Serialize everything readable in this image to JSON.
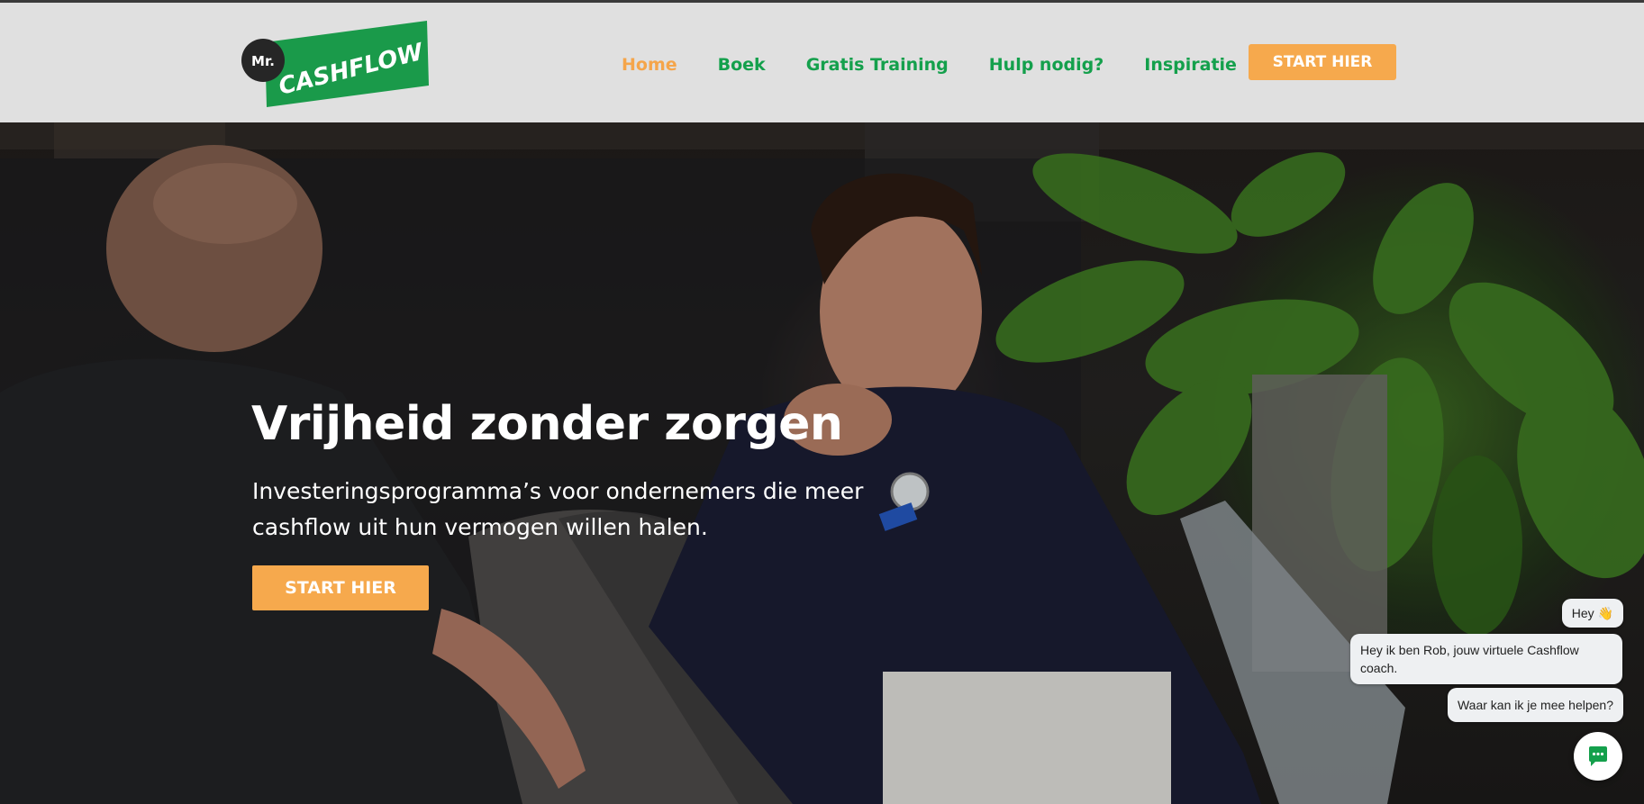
{
  "header": {
    "logo": {
      "prefix": "Mr.",
      "word": "CASHFLOW"
    },
    "nav": [
      {
        "label": "Home",
        "active": true
      },
      {
        "label": "Boek",
        "active": false
      },
      {
        "label": "Gratis Training",
        "active": false
      },
      {
        "label": "Hulp nodig?",
        "active": false
      },
      {
        "label": "Inspiratie",
        "active": false
      }
    ],
    "cta_label": "START HIER"
  },
  "hero": {
    "title": "Vrijheid zonder zorgen",
    "subtitle": "Investeringsprogramma’s voor ondernemers die meer cashflow uit hun vermogen willen halen.",
    "cta_label": "START HIER"
  },
  "chat": {
    "messages": [
      "Hey 👋",
      "Hey ik ben Rob, jouw virtuele Cashflow coach.",
      "Waar kan ik je mee helpen?"
    ],
    "launcher_icon": "chat-bubble-icon"
  },
  "colors": {
    "brand_green": "#14a04c",
    "accent_orange": "#f6a94d",
    "header_bg": "#e0e0e0"
  }
}
